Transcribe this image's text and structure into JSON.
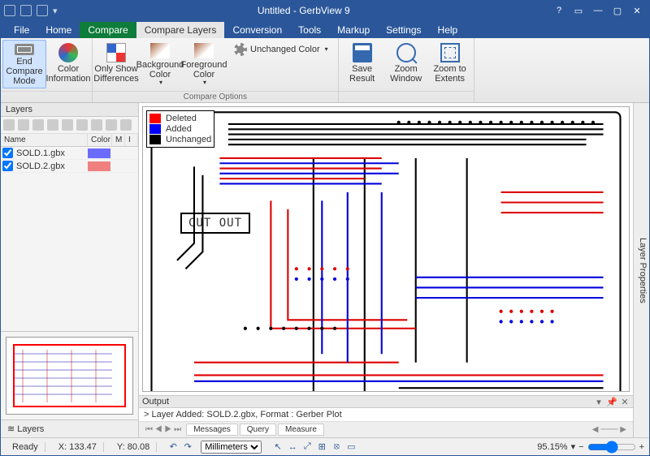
{
  "title": "Untitled - GerbView 9",
  "tabs": {
    "file": "File",
    "home": "Home",
    "compare": "Compare Layers",
    "conversion": "Conversion",
    "tools": "Tools",
    "markup": "Markup",
    "settings": "Settings",
    "help": "Help",
    "context": "Compare"
  },
  "ribbon": {
    "endCompare": "End Compare Mode",
    "colorInfo": "Color Information",
    "onlyDiff": "Only Show Differences",
    "bgColor": "Background Color",
    "fgColor": "Foreground Color",
    "unchangedColor": "Unchanged Color",
    "compareOptions": "Compare Options",
    "saveResult": "Save Result",
    "zoomWindow": "Zoom Window",
    "zoomExtents": "Zoom to Extents"
  },
  "layersPanel": {
    "title": "Layers",
    "headers": {
      "name": "Name",
      "color": "Color",
      "m": "M",
      "i": "I"
    },
    "rows": [
      {
        "name": "SOLD.1.gbx",
        "swClass": "sw1"
      },
      {
        "name": "SOLD.2.gbx",
        "swClass": "sw2"
      }
    ],
    "accLabel": "Layers"
  },
  "rightPanel": "Layer Properties",
  "legend": {
    "deleted": "Deleted",
    "added": "Added",
    "unchanged": "Unchanged"
  },
  "cutout": "CUT OUT",
  "output": {
    "title": "Output",
    "msg": "> Layer Added: SOLD.2.gbx, Format : Gerber Plot",
    "tabs": {
      "messages": "Messages",
      "query": "Query",
      "measure": "Measure"
    }
  },
  "status": {
    "ready": "Ready",
    "x": "X: 133.47",
    "y": "Y: 80.08",
    "units": "Millimeters",
    "zoom": "95.15%"
  }
}
